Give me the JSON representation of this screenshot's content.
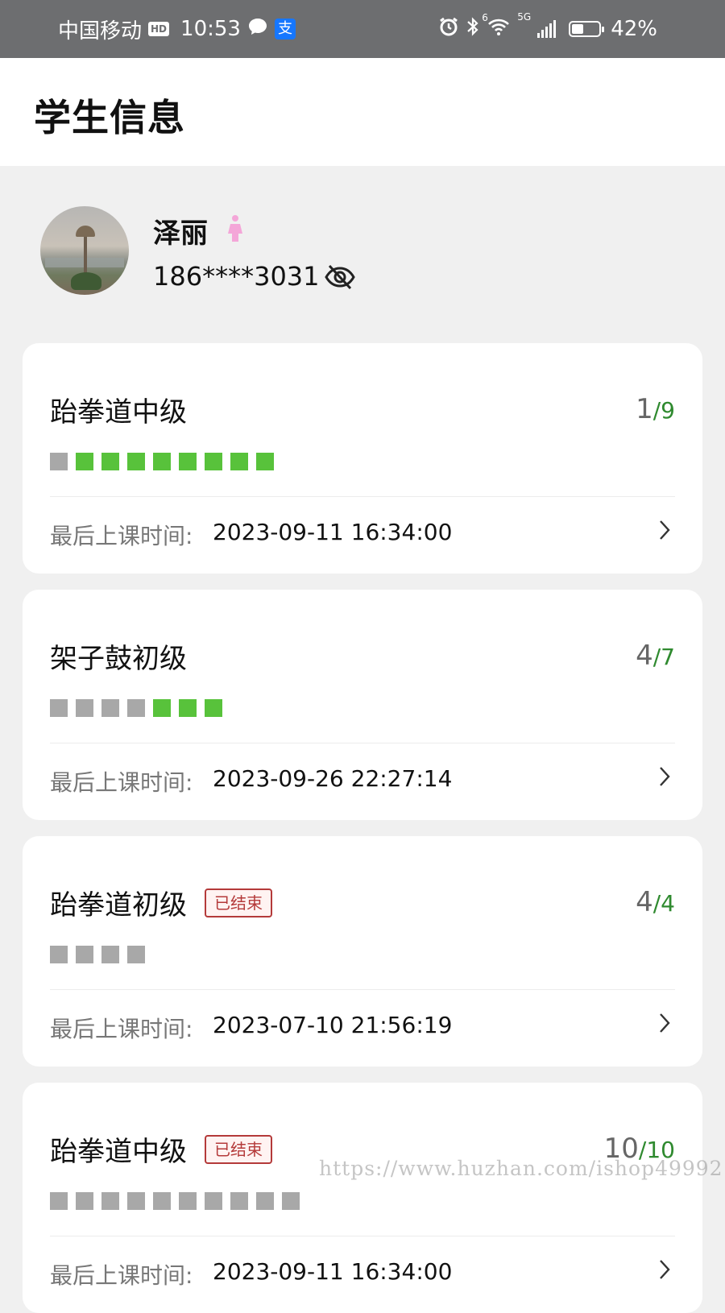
{
  "status_bar": {
    "carrier": "中国移动",
    "hd": "HD",
    "time": "10:53",
    "alipay": "支",
    "net_sup": "6",
    "net_gen": "5G",
    "battery": "42%",
    "battery_level": 0.42
  },
  "header": {
    "title": "学生信息"
  },
  "profile": {
    "name": "泽丽",
    "phone": "186****3031"
  },
  "courses": [
    {
      "title": "跆拳道中级",
      "ended": false,
      "done": "1",
      "total": "9",
      "squares": [
        0,
        1,
        1,
        1,
        1,
        1,
        1,
        1,
        1
      ],
      "last_label": "最后上课时间:",
      "last_time": "2023-09-11 16:34:00"
    },
    {
      "title": "架子鼓初级",
      "ended": false,
      "done": "4",
      "total": "7",
      "squares": [
        0,
        0,
        0,
        0,
        1,
        1,
        1
      ],
      "last_label": "最后上课时间:",
      "last_time": "2023-09-26 22:27:14"
    },
    {
      "title": "跆拳道初级",
      "ended": true,
      "ended_label": "已结束",
      "done": "4",
      "total": "4",
      "squares": [
        0,
        0,
        0,
        0
      ],
      "last_label": "最后上课时间:",
      "last_time": "2023-07-10 21:56:19"
    },
    {
      "title": "跆拳道中级",
      "ended": true,
      "ended_label": "已结束",
      "done": "10",
      "total": "10",
      "squares": [
        0,
        0,
        0,
        0,
        0,
        0,
        0,
        0,
        0,
        0
      ],
      "last_label": "最后上课时间:",
      "last_time": "2023-09-11 16:34:00"
    }
  ],
  "watermark": "https://www.huzhan.com/ishop49992",
  "colors": {
    "status_bar_bg": "#6d6e70",
    "square_on": "#58c23b",
    "square_off": "#a8a8a8",
    "count_green": "#2f8a2f",
    "ended_red": "#b43a3a",
    "female_pink": "#f4a6d8"
  }
}
